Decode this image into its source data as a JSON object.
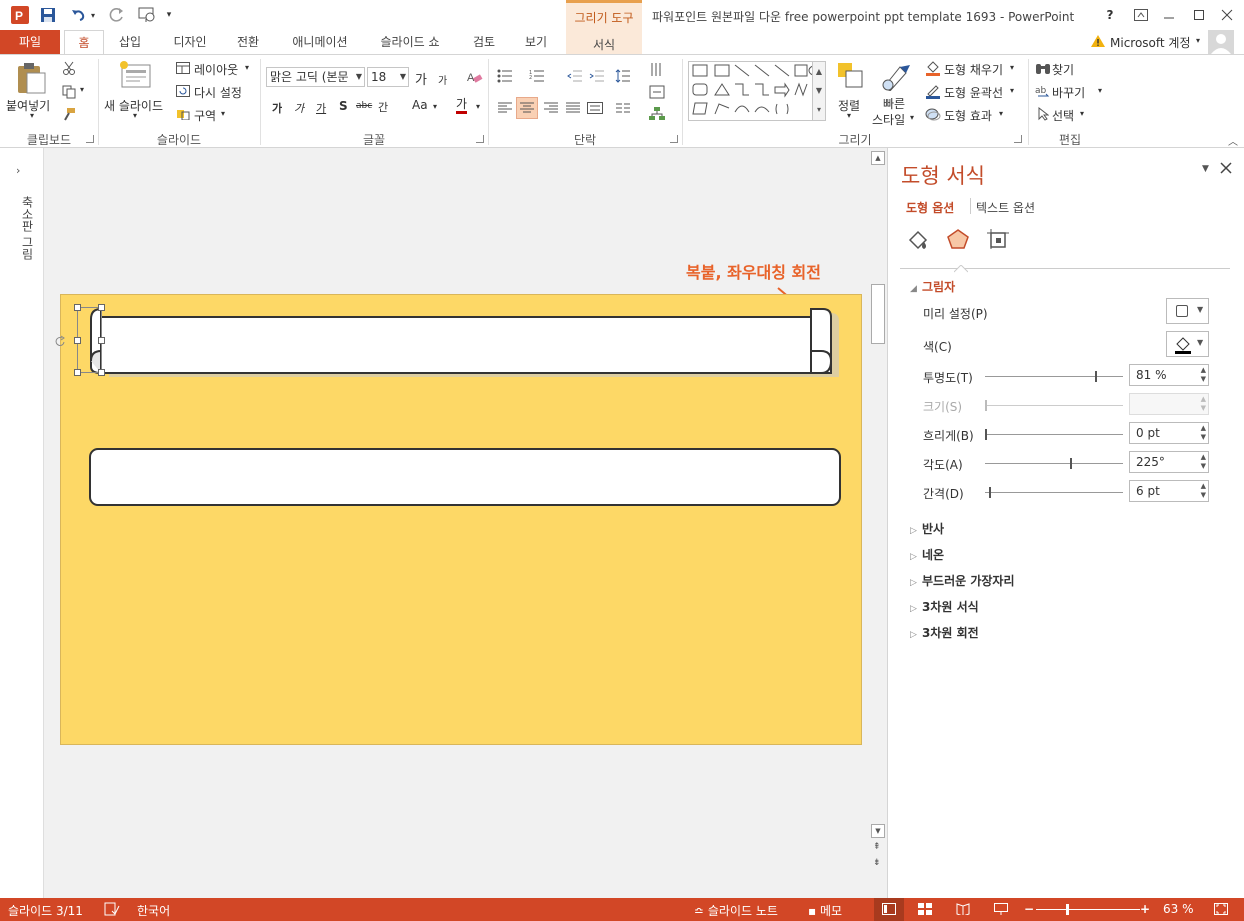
{
  "window": {
    "title": "파워포인트 원본파일 다운 free powerpoint ppt template 1693 - PowerPoint",
    "context_tab_group": "그리기 도구",
    "context_tab": "서식",
    "help": "?",
    "account": "Microsoft 계정"
  },
  "tabs": [
    "파일",
    "홈",
    "삽입",
    "디자인",
    "전환",
    "애니메이션",
    "슬라이드 쇼",
    "검토",
    "보기"
  ],
  "ribbon": {
    "clipboard": {
      "paste": "붙여넣기",
      "label": "클립보드"
    },
    "slides": {
      "new_slide": "새 슬라이드",
      "layout": "레이아웃",
      "reset": "다시 설정",
      "section": "구역",
      "label": "슬라이드"
    },
    "font": {
      "name": "맑은 고딕 (본문",
      "size": "18",
      "label": "글꼴",
      "bold": "가",
      "italic": "가",
      "underline": "가",
      "shadow": "S",
      "strike": "abc",
      "spacing": "간",
      "case": "Aa",
      "color": "가",
      "grow": "가",
      "shrink": "가"
    },
    "paragraph": {
      "label": "단락"
    },
    "drawing": {
      "arrange": "정렬",
      "quick_styles_1": "빠른",
      "quick_styles_2": "스타일",
      "fill": "도형 채우기",
      "outline": "도형 윤곽선",
      "effects": "도형 효과",
      "label": "그리기"
    },
    "editing": {
      "find": "찾기",
      "replace": "바꾸기",
      "select": "선택",
      "label": "편집"
    }
  },
  "left_pane": {
    "label": "축소판 그림"
  },
  "slide": {
    "annotation": "복붙, 좌우대칭 회전"
  },
  "format_pane": {
    "title": "도형 서식",
    "tab_shape": "도형 옵션",
    "tab_text": "텍스트 옵션",
    "shadow_section": "그림자",
    "presets": "미리 설정(P)",
    "color": "색(C)",
    "transparency": {
      "label": "투명도(T)",
      "value": "81 %",
      "level": 0.81
    },
    "size": {
      "label": "크기(S)",
      "value": ""
    },
    "blur": {
      "label": "흐리게(B)",
      "value": "0 pt",
      "level": 0
    },
    "angle": {
      "label": "각도(A)",
      "value": "225°",
      "level": 0.625
    },
    "distance": {
      "label": "간격(D)",
      "value": "6 pt",
      "level": 0.03
    },
    "sections": [
      "반사",
      "네온",
      "부드러운 가장자리",
      "3차원 서식",
      "3차원 회전"
    ]
  },
  "status": {
    "slide": "슬라이드 3/11",
    "language": "한국어",
    "notes": "슬라이드 노트",
    "comments": "메모",
    "zoom": "63 %"
  },
  "colors": {
    "accent": "#d24726",
    "slide_bg": "#fdd866",
    "annotation": "#e8632a"
  }
}
